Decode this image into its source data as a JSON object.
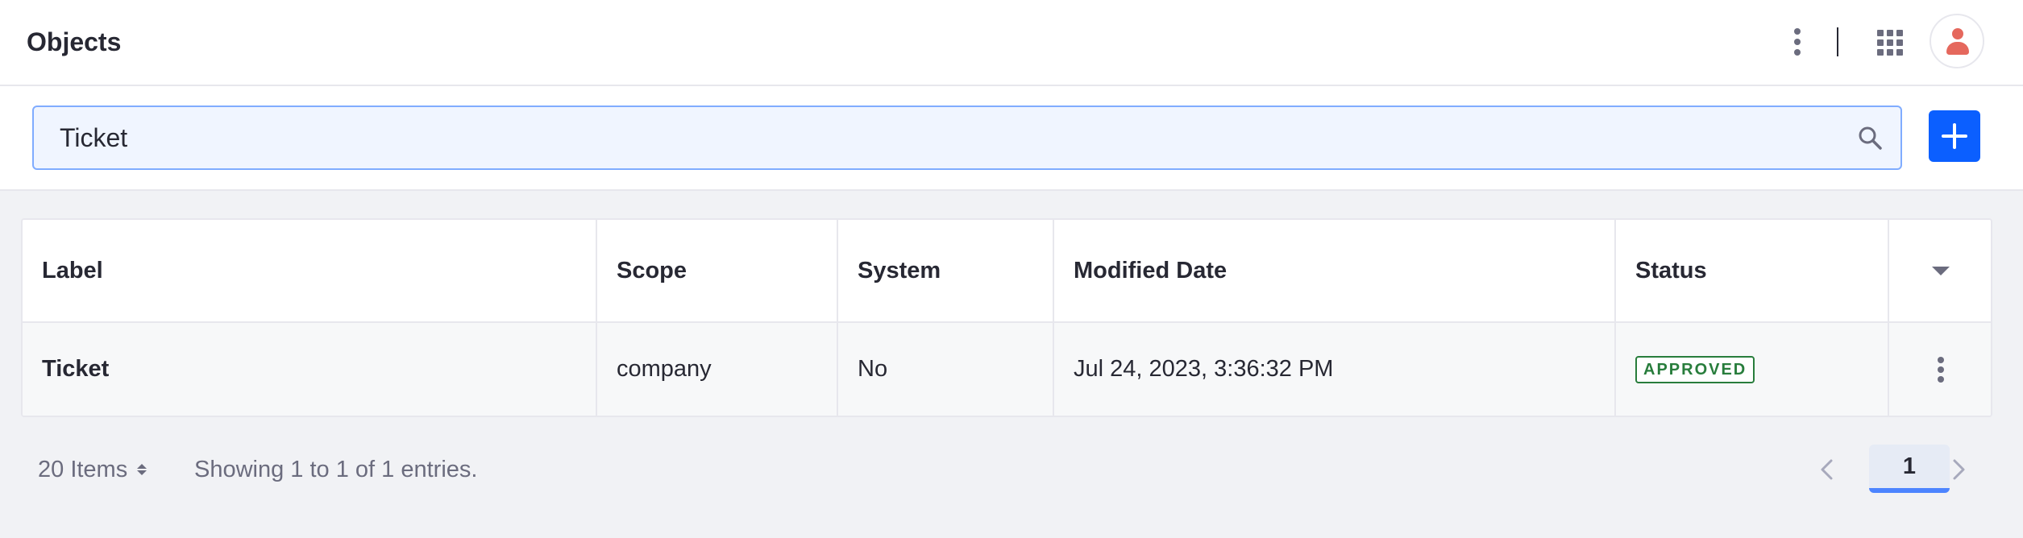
{
  "header": {
    "title": "Objects"
  },
  "search": {
    "value": "Ticket"
  },
  "table": {
    "columns": [
      "Label",
      "Scope",
      "System",
      "Modified Date",
      "Status"
    ],
    "rows": [
      {
        "label": "Ticket",
        "scope": "company",
        "system": "No",
        "modified_date": "Jul 24, 2023, 3:36:32 PM",
        "status": "APPROVED"
      }
    ]
  },
  "footer": {
    "items_per_page": "20 Items",
    "showing": "Showing 1 to 1 of 1 entries.",
    "current_page": "1"
  },
  "colors": {
    "primary": "#0b5fff",
    "approved": "#287d3c",
    "avatar": "#e5685d",
    "search_border": "#80acff"
  },
  "icons": [
    "kebab-menu-icon",
    "apps-grid-icon",
    "user-avatar-icon",
    "search-icon",
    "plus-icon",
    "caret-down-icon",
    "sort-icon",
    "chevron-left-icon",
    "chevron-right-icon"
  ]
}
